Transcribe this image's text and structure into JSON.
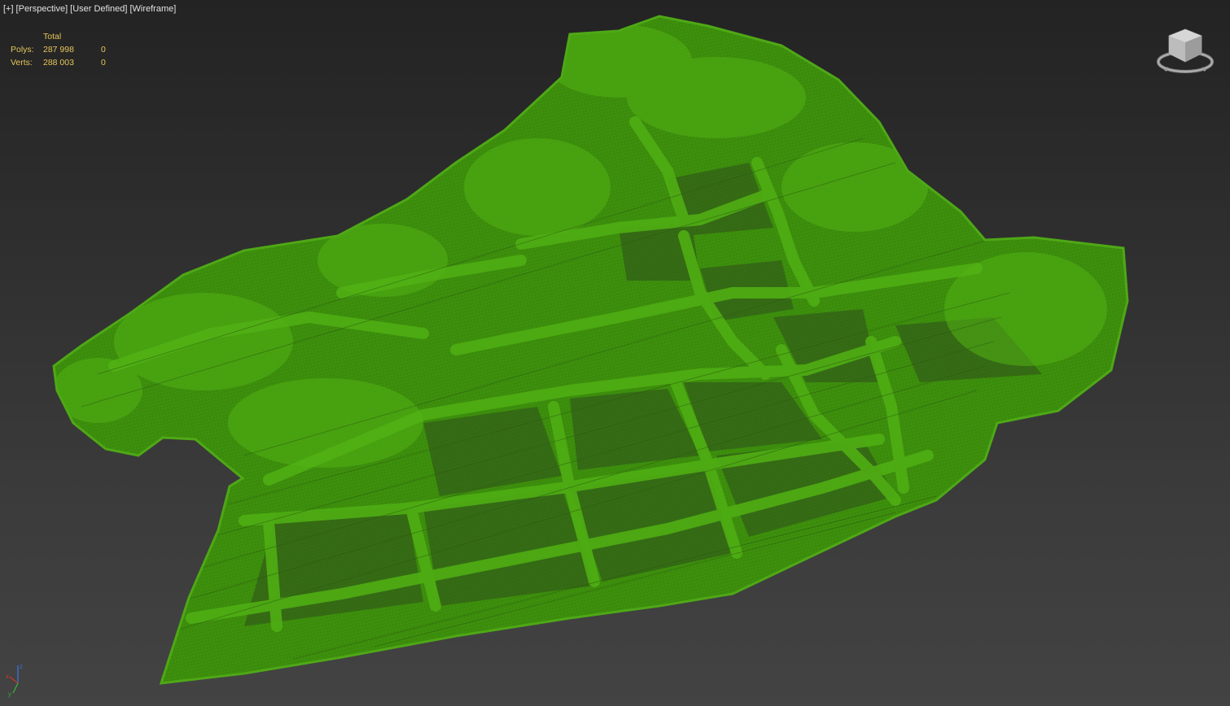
{
  "viewport": {
    "labels": {
      "plus": "[+]",
      "view": "[Perspective]",
      "camera": "[User Defined]",
      "shading": "[Wireframe]"
    },
    "stats": {
      "header": "Total",
      "polys_label": "Polys:",
      "polys_total": "287 998",
      "polys_selected": "0",
      "verts_label": "Verts:",
      "verts_total": "288 003",
      "verts_selected": "0"
    },
    "axis": {
      "x": "x",
      "y": "y",
      "z": "z"
    }
  },
  "colors": {
    "wireframe": "#3f8a0e",
    "wireframe_dense": "#49a012",
    "stats_text": "#e7c65a",
    "label_text": "#e2e2e2",
    "axis_x": "#c0392b",
    "axis_y": "#3aa43a",
    "axis_z": "#3d6fd1"
  },
  "icons": {
    "viewcube": "viewcube-icon",
    "axis": "axis-tripod-icon"
  }
}
